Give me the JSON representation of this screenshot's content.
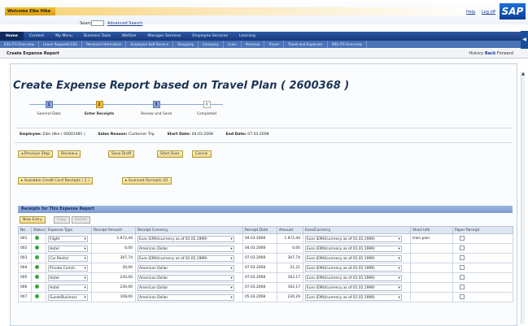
{
  "header": {
    "welcome": "Welcome Elke Hike",
    "search_label": "Search",
    "advanced_search": "Advanced Search",
    "help": "Help",
    "logoff": "Log off",
    "logo": "SAP"
  },
  "nav_primary": [
    "Home",
    "Content",
    "My Menu",
    "Business Tools",
    "Welfare",
    "Manager Services",
    "Employee Services",
    "Learning"
  ],
  "nav_secondary": [
    "ESS ITS Overview",
    "Leave Requests ESS",
    "Personal Information",
    "Employee Self Service",
    "Shopping",
    "Company",
    "Links",
    "Personal",
    "Travel",
    "Travel and Expenses",
    "SRS ITS Overview"
  ],
  "page_bar": {
    "title": "Create Expense Report",
    "history": "History",
    "back": "Back",
    "forward": "Forward"
  },
  "main": {
    "title": "Create Expense Report based on Travel Plan ( 2600368 )"
  },
  "steps": [
    {
      "num": "1",
      "label": "General Data"
    },
    {
      "num": "2",
      "label": "Enter Receipts"
    },
    {
      "num": "3",
      "label": "Review and Send"
    },
    {
      "num": "4",
      "label": "Completed"
    }
  ],
  "info": {
    "employee_label": "Employee:",
    "employee_value": "Elke Hike ( 00001481 )",
    "reason_label": "Sales Reason:",
    "reason_value": "Customer Trip",
    "start_label": "Start Date:",
    "start_value": "04.03.2008",
    "end_label": "End Date:",
    "end_value": "07.03.2008"
  },
  "actions": {
    "previous": "Previous Step",
    "review": "Review",
    "save_draft": "Save Draft",
    "start_over": "Start Over",
    "cancel": "Cancel"
  },
  "receipt_links": {
    "credit_card": "Available Credit Card Receipts ( 2 )",
    "scanned": "Scanned Receipts (0)"
  },
  "receipts": {
    "section_title": "Receipts for This Expense Report",
    "new_entry": "New Entry",
    "copy": "Copy",
    "delete": "Delete",
    "columns": [
      "No.",
      "Status",
      "Expense Type",
      "Receipt Amount",
      "Receipt Currency",
      "Receipt Date",
      "Amount",
      "Euro/Currency",
      "Short Info",
      "Paper Receipt"
    ],
    "rows": [
      {
        "no": "001",
        "type": "Flight",
        "amount": "1.972,44",
        "currency": "Euro (EMU/currency as of 01.01.1999)",
        "date": "04.03.2008",
        "amt2": "1.972,44",
        "eur": "Euro (EMU/currency as of 01.01.1999)",
        "info": "train plan"
      },
      {
        "no": "002",
        "type": "Hotel",
        "amount": "0,00",
        "currency": "American Dollar",
        "date": "04.03.2008",
        "amt2": "0,00",
        "eur": "Euro (EMU/currency as of 01.01.1999)",
        "info": ""
      },
      {
        "no": "003",
        "type": "Car Rental",
        "amount": "307,74",
        "currency": "Euro (EMU/currency as of 01.01.1999)",
        "date": "07.03.2008",
        "amt2": "307,74",
        "eur": "Euro (EMU/currency as of 01.01.1999)",
        "info": ""
      },
      {
        "no": "004",
        "type": "Private Comm.",
        "amount": "30,00",
        "currency": "American Dollar",
        "date": "07.03.2008",
        "amt2": "21,21",
        "eur": "Euro (EMU/currency as of 01.01.1999)",
        "info": ""
      },
      {
        "no": "005",
        "type": "Hotel",
        "amount": "230,00",
        "currency": "American Dollar",
        "date": "07.03.2008",
        "amt2": "162,17",
        "eur": "Euro (EMU/currency as of 01.01.1999)",
        "info": ""
      },
      {
        "no": "006",
        "type": "Hotel",
        "amount": "230,00",
        "currency": "American Dollar",
        "date": "07.03.2008",
        "amt2": "162,17",
        "eur": "Euro (EMU/currency as of 01.01.1999)",
        "info": ""
      },
      {
        "no": "007",
        "type": "Guest/Business",
        "amount": "108,00",
        "currency": "American Dollar",
        "date": "05.03.2008",
        "amt2": "230,29",
        "eur": "Euro (EMU/currency as of 01.01.1999)",
        "info": ""
      }
    ]
  },
  "colors": {
    "nav_dark": "#16387a",
    "nav_light": "#4b73b8",
    "accent": "#f2c23a",
    "title": "#1c3456"
  }
}
